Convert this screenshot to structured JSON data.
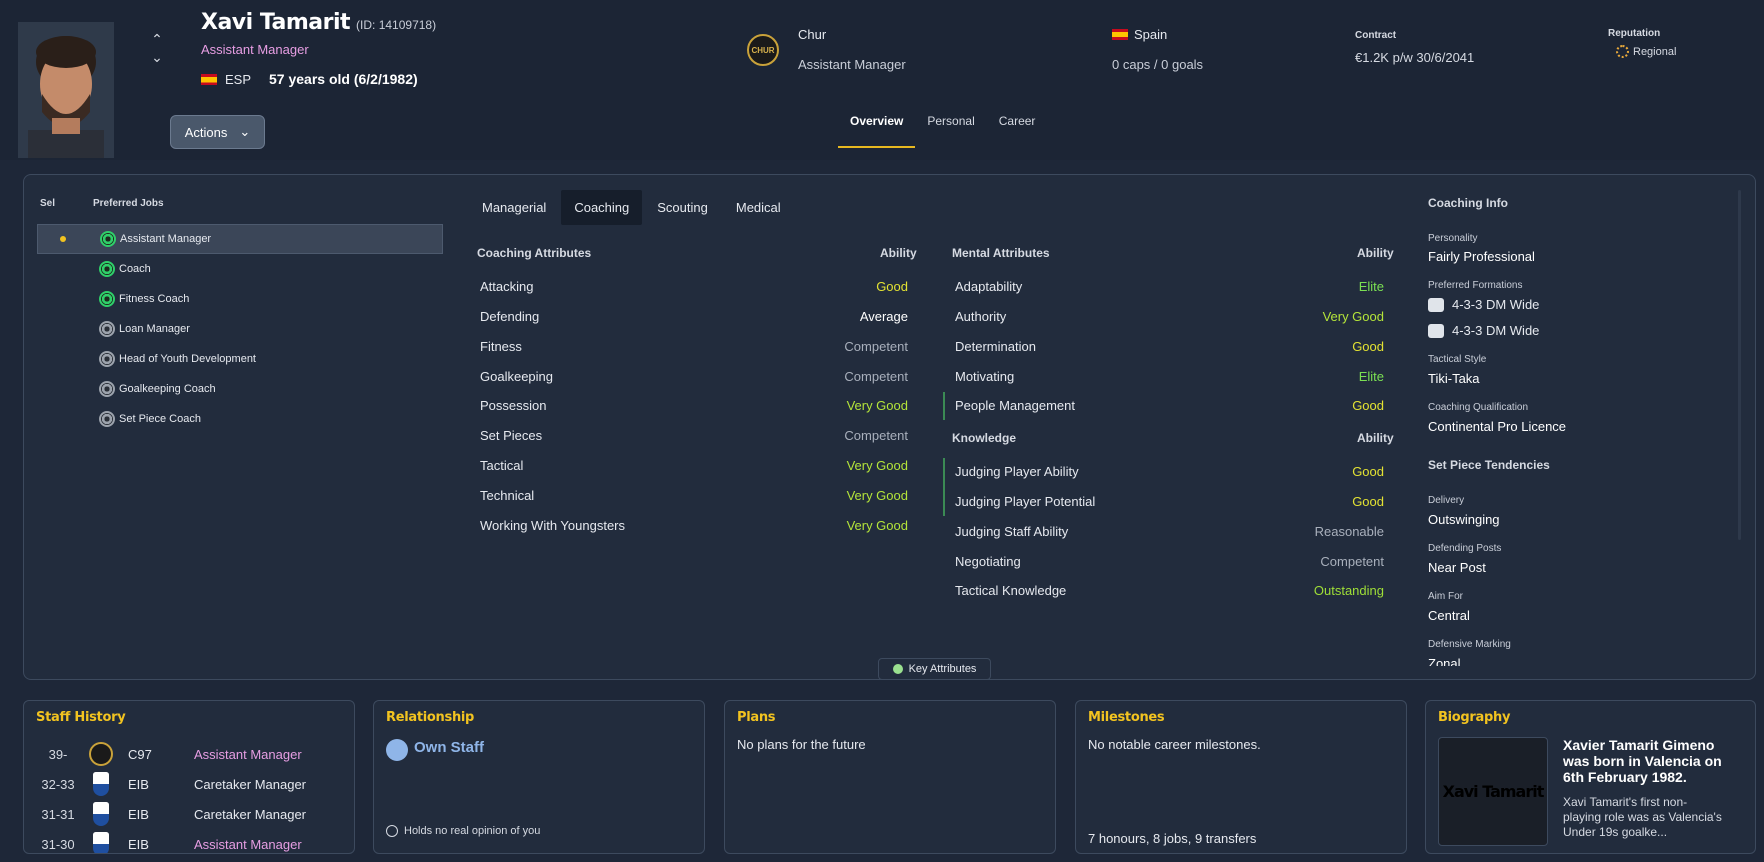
{
  "header": {
    "name": "Xavi Tamarit",
    "id": "(ID: 14109718)",
    "role": "Assistant Manager",
    "nation_code": "ESP",
    "age": "57 years old (6/2/1982)",
    "actions_label": "Actions",
    "club_badge_text": "CHUR",
    "club_name": "Chur",
    "club_role": "Assistant Manager",
    "nation": "Spain",
    "caps": "0 caps / 0 goals",
    "contract_label": "Contract",
    "contract_value": "€1.2K p/w 30/6/2041",
    "reputation_label": "Reputation",
    "reputation_value": "Regional",
    "tabs": [
      "Overview",
      "Personal",
      "Career"
    ]
  },
  "jobs": {
    "sel_header": "Sel",
    "jobs_header": "Preferred Jobs",
    "items": [
      {
        "label": "Assistant Manager",
        "icon": "green"
      },
      {
        "label": "Coach",
        "icon": "green"
      },
      {
        "label": "Fitness Coach",
        "icon": "green"
      },
      {
        "label": "Loan Manager",
        "icon": "grey"
      },
      {
        "label": "Head of Youth Development",
        "icon": "grey"
      },
      {
        "label": "Goalkeeping Coach",
        "icon": "grey"
      },
      {
        "label": "Set Piece Coach",
        "icon": "grey"
      }
    ]
  },
  "sub_tabs": [
    "Managerial",
    "Coaching",
    "Scouting",
    "Medical"
  ],
  "coaching": {
    "title": "Coaching Attributes",
    "ability": "Ability",
    "rows": [
      {
        "name": "Attacking",
        "value": "Good"
      },
      {
        "name": "Defending",
        "value": "Average"
      },
      {
        "name": "Fitness",
        "value": "Competent"
      },
      {
        "name": "Goalkeeping",
        "value": "Competent"
      },
      {
        "name": "Possession",
        "value": "Very Good"
      },
      {
        "name": "Set Pieces",
        "value": "Competent"
      },
      {
        "name": "Tactical",
        "value": "Very Good"
      },
      {
        "name": "Technical",
        "value": "Very Good"
      },
      {
        "name": "Working With Youngsters",
        "value": "Very Good"
      }
    ]
  },
  "mental": {
    "title": "Mental Attributes",
    "ability": "Ability",
    "rows": [
      {
        "name": "Adaptability",
        "value": "Elite"
      },
      {
        "name": "Authority",
        "value": "Very Good"
      },
      {
        "name": "Determination",
        "value": "Good"
      },
      {
        "name": "Motivating",
        "value": "Elite"
      },
      {
        "name": "People Management",
        "value": "Good"
      }
    ]
  },
  "knowledge": {
    "title": "Knowledge",
    "ability": "Ability",
    "rows": [
      {
        "name": "Judging Player Ability",
        "value": "Good"
      },
      {
        "name": "Judging Player Potential",
        "value": "Good"
      },
      {
        "name": "Judging Staff Ability",
        "value": "Reasonable"
      },
      {
        "name": "Negotiating",
        "value": "Competent"
      },
      {
        "name": "Tactical Knowledge",
        "value": "Outstanding"
      }
    ]
  },
  "info": {
    "title": "Coaching Info",
    "personality_label": "Personality",
    "personality": "Fairly Professional",
    "formations_label": "Preferred Formations",
    "formation_1": "4-3-3 DM Wide",
    "formation_2": "4-3-3 DM Wide",
    "style_label": "Tactical Style",
    "style": "Tiki-Taka",
    "qual_label": "Coaching Qualification",
    "qual": "Continental Pro Licence",
    "setpiece_title": "Set Piece Tendencies",
    "delivery_label": "Delivery",
    "delivery": "Outswinging",
    "posts_label": "Defending Posts",
    "posts": "Near Post",
    "aim_label": "Aim For",
    "aim": "Central",
    "marking_label": "Defensive Marking",
    "marking": "Zonal"
  },
  "key_attributes_label": "Key Attributes",
  "staff_history": {
    "title": "Staff History",
    "rows": [
      {
        "years": "39-",
        "club": "C97",
        "role": "Assistant Manager",
        "pink": true,
        "badge": "chur"
      },
      {
        "years": "32-33",
        "club": "EIB",
        "role": "Caretaker Manager",
        "pink": false,
        "badge": "eib"
      },
      {
        "years": "31-31",
        "club": "EIB",
        "role": "Caretaker Manager",
        "pink": false,
        "badge": "eib"
      },
      {
        "years": "31-30",
        "club": "EIB",
        "role": "Assistant Manager",
        "pink": true,
        "badge": "eib"
      }
    ]
  },
  "relationship": {
    "title": "Relationship",
    "status": "Own Staff",
    "note": "Holds no real opinion of you"
  },
  "plans": {
    "title": "Plans",
    "text": "No plans for the future"
  },
  "milestones": {
    "title": "Milestones",
    "text": "No notable career milestones.",
    "footer": "7 honours, 8 jobs, 9 transfers"
  },
  "biography": {
    "title": "Biography",
    "image_text": "Xavi Tamarit",
    "headline": "Xavier Tamarit Gimeno was born in Valencia on 6th February 1982.",
    "body": "Xavi Tamarit's first non-playing role was as Valencia's Under 19s goalke..."
  },
  "colors": {
    "accent_gold": "#f2c320",
    "role_pink": "#e79ee3",
    "value_good": "#e3e233",
    "value_very_good": "#b5e53a",
    "value_elite": "#7be053"
  }
}
